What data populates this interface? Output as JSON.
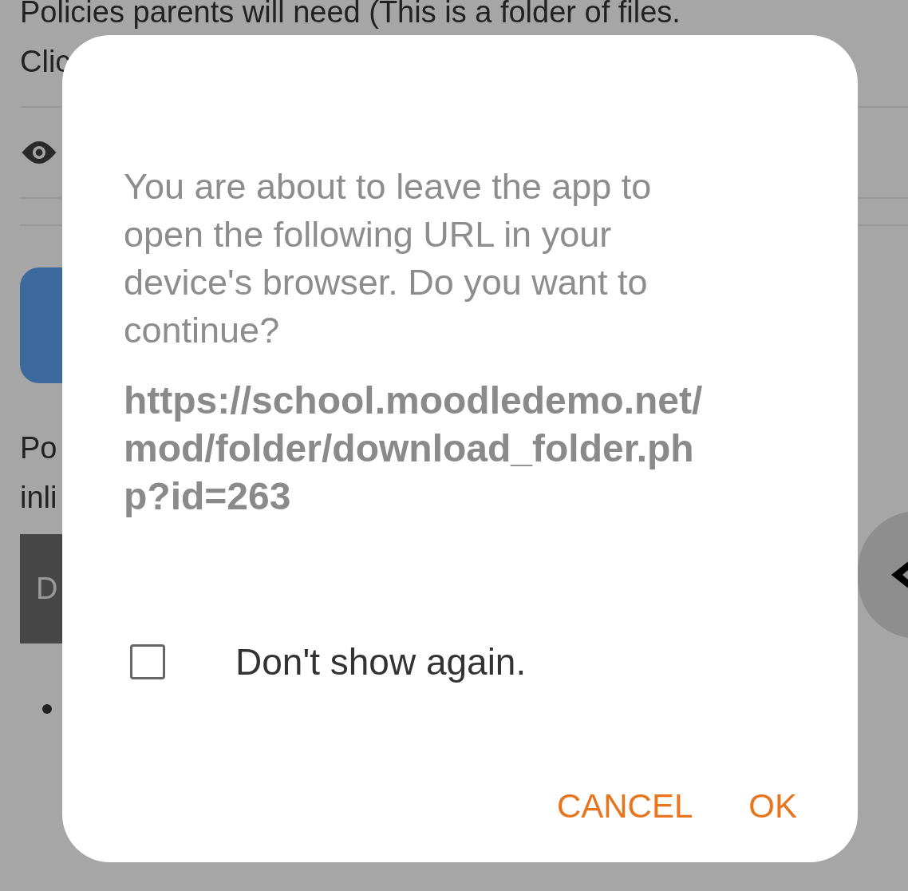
{
  "background": {
    "heading_lines": [
      "Policies parents will need  (This is a folder of files.",
      "Clic"
    ],
    "paragraph_lines": [
      "Po",
      "inli"
    ],
    "button": "D"
  },
  "dialog": {
    "message": "You are about to leave the app to open the following URL in your device's browser. Do you want to continue?",
    "url": "https://school.moodledemo.net/mod/folder/download_folder.php?id=263",
    "checkbox": {
      "label": "Don't show again.",
      "checked": false
    },
    "buttons": [
      {
        "label": "CANCEL"
      },
      {
        "label": "OK"
      }
    ]
  }
}
